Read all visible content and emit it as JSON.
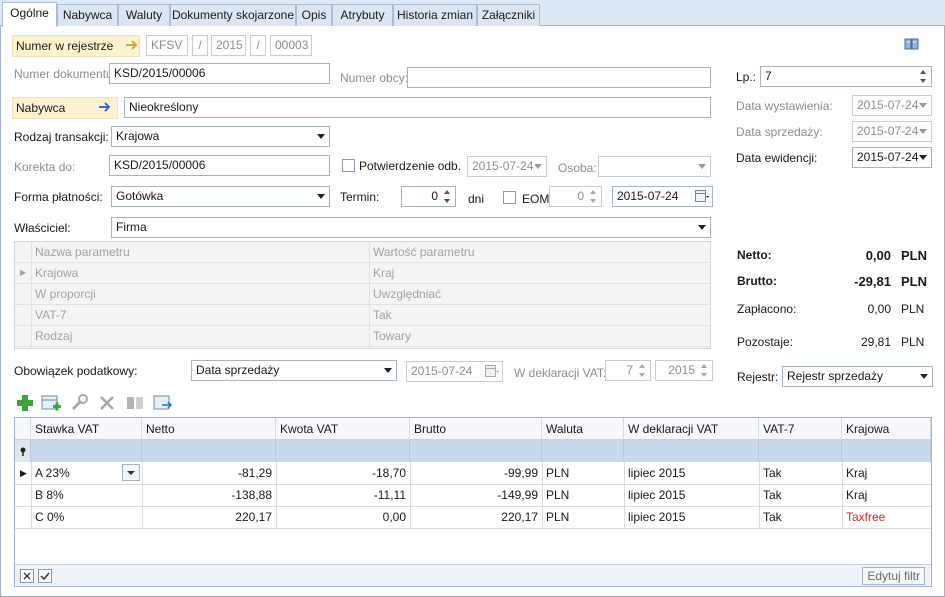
{
  "tabs": [
    "Ogólne",
    "Nabywca",
    "Waluty",
    "Dokumenty skojarzone",
    "Opis",
    "Atrybuty",
    "Historia zmian",
    "Załączniki"
  ],
  "header": {
    "numer_rejestr_label": "Numer w rejestrze",
    "nr_prefix": "KFSV",
    "nr_sep1": "/",
    "nr_year": "2015",
    "nr_sep2": "/",
    "nr_number": "00003",
    "numer_dok_label": "Numer dokumentu:",
    "numer_dok_value": "KSD/2015/00006",
    "numer_obcy_label": "Numer obcy:",
    "numer_obcy_value": "",
    "nabywca_label": "Nabywca",
    "nabywca_value": "Nieokreślony",
    "rodzaj_label": "Rodzaj transakcji:",
    "rodzaj_value": "Krajowa",
    "korekta_label": "Korekta do:",
    "korekta_value": "KSD/2015/00006",
    "potwierdzenie_label": "Potwierdzenie odb.",
    "potwierdzenie_date": "2015-07-24",
    "osoba_label": "Osoba:",
    "osoba_value": "",
    "forma_label": "Forma płatności:",
    "forma_value": "Gotówka",
    "termin_label": "Termin:",
    "termin_value": "0",
    "dni_label": "dni",
    "eom_label": "EOM",
    "eom_value": "0",
    "termin_date": "2015-07-24",
    "wlasciciel_label": "Właściciel:",
    "wlasciciel_value": "Firma"
  },
  "right": {
    "lp_label": "Lp.:",
    "lp_value": "7",
    "data_wyst_label": "Data wystawienia:",
    "data_wyst_value": "2015-07-24",
    "data_sprz_label": "Data sprzedaży:",
    "data_sprz_value": "2015-07-24",
    "data_ewid_label": "Data ewidencji:",
    "data_ewid_value": "2015-07-24",
    "netto_label": "Netto:",
    "netto_value": "0,00",
    "netto_cur": "PLN",
    "brutto_label": "Brutto:",
    "brutto_value": "-29,81",
    "brutto_cur": "PLN",
    "zaplacono_label": "Zapłacono:",
    "zaplacono_value": "0,00",
    "zaplacono_cur": "PLN",
    "pozostaje_label": "Pozostaje:",
    "pozostaje_value": "29,81",
    "pozostaje_cur": "PLN",
    "rejestr_label": "Rejestr:",
    "rejestr_value": "Rejestr sprzedaży"
  },
  "params": {
    "col1": "Nazwa parametru",
    "col2": "Wartość parametru",
    "rows": [
      {
        "name": "Krajowa",
        "value": "Kraj"
      },
      {
        "name": "W proporcji",
        "value": "Uwzględniać"
      },
      {
        "name": "VAT-7",
        "value": "Tak"
      },
      {
        "name": "Rodzaj",
        "value": "Towary"
      }
    ]
  },
  "tax": {
    "obowiazek_label": "Obowiązek podatkowy:",
    "obowiazek_value": "Data sprzedaży",
    "obowiazek_date": "2015-07-24",
    "deklaracja_label": "W deklaracji VAT:",
    "deklaracja_month": "7",
    "deklaracja_year": "2015"
  },
  "grid": {
    "columns": [
      "Stawka VAT",
      "Netto",
      "Kwota VAT",
      "Brutto",
      "Waluta",
      "W deklaracji VAT",
      "VAT-7",
      "Krajowa"
    ],
    "rows": [
      {
        "stawka": "A 23%",
        "netto": "-81,29",
        "kwota": "-18,70",
        "brutto": "-99,99",
        "waluta": "PLN",
        "deklaracja": "lipiec 2015",
        "vat7": "Tak",
        "krajowa": "Kraj"
      },
      {
        "stawka": "B 8%",
        "netto": "-138,88",
        "kwota": "-11,11",
        "brutto": "-149,99",
        "waluta": "PLN",
        "deklaracja": "lipiec 2015",
        "vat7": "Tak",
        "krajowa": "Kraj"
      },
      {
        "stawka": "C 0%",
        "netto": "220,17",
        "kwota": "0,00",
        "brutto": "220,17",
        "waluta": "PLN",
        "deklaracja": "lipiec 2015",
        "vat7": "Tak",
        "krajowa": "Taxfree"
      }
    ],
    "edit_filter_label": "Edytuj filtr"
  },
  "colors": {
    "taxfree": "#e0231c",
    "highlight": "#fdf2cf",
    "tab_bg": "#dfe8f5"
  }
}
